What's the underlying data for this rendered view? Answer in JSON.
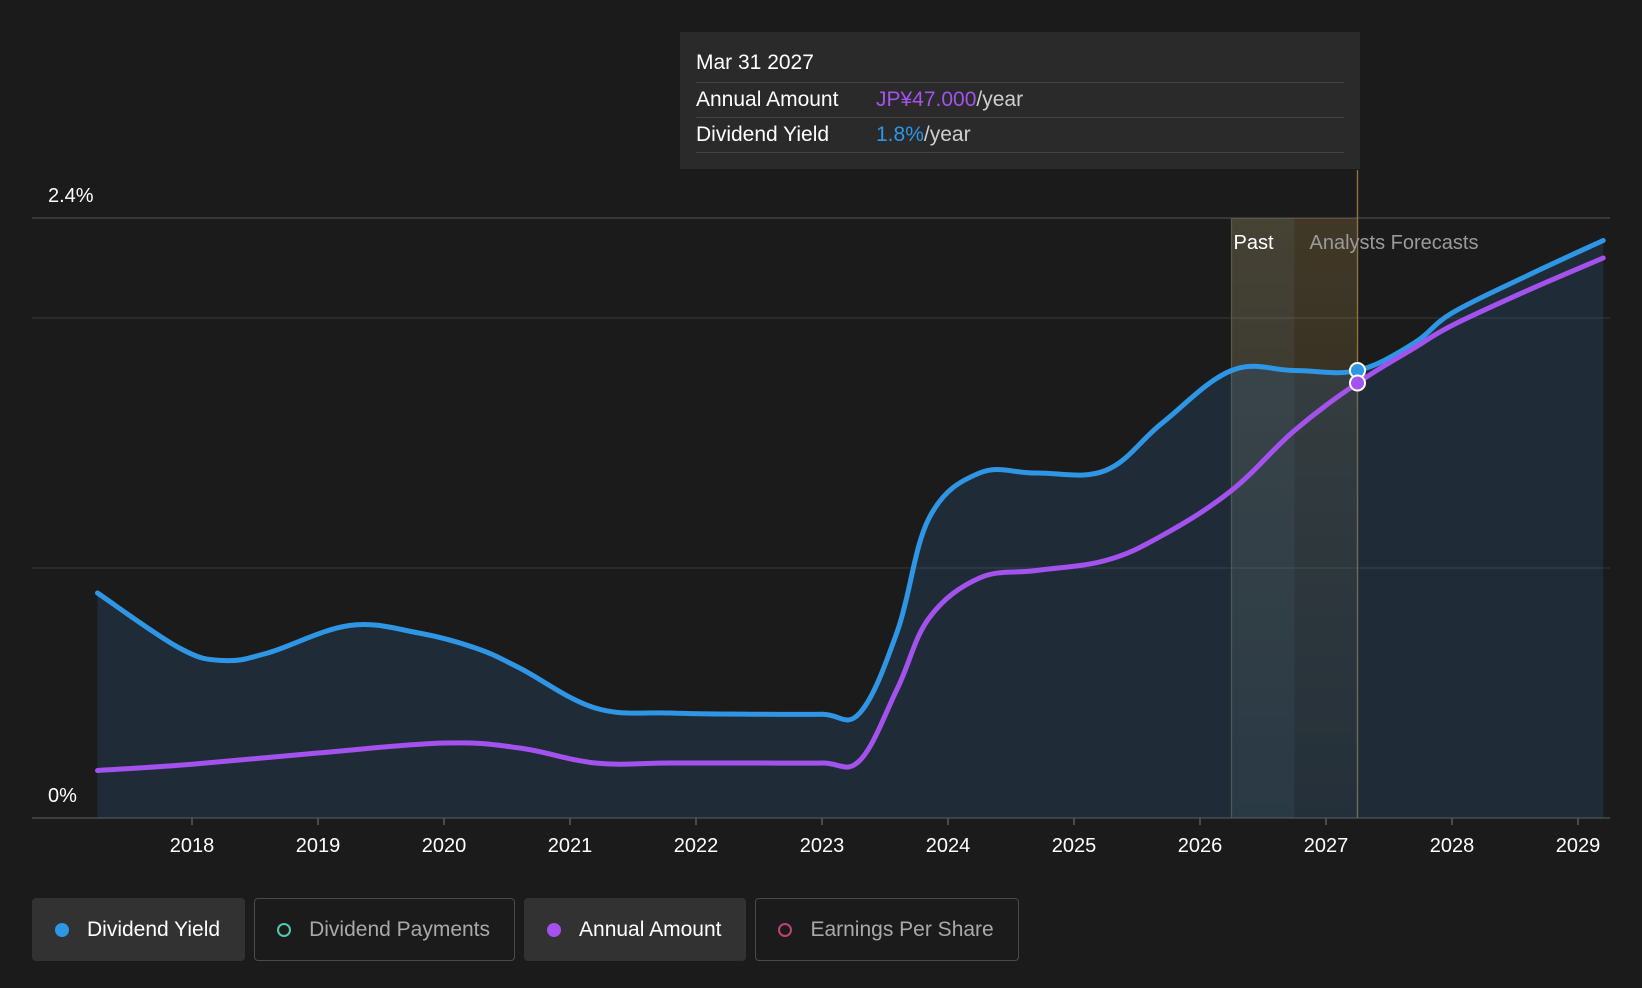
{
  "colors": {
    "background": "#1b1b1b",
    "dividend_yield": "#2e96e4",
    "annual_amount": "#a352ee",
    "dividend_payments": "#55c7b0",
    "earnings_per_share": "#c0407a",
    "forecast_band": "#c8a050",
    "gridline": "#3a3a3a"
  },
  "tooltip": {
    "date": "Mar 31 2027",
    "rows": [
      {
        "label": "Annual Amount",
        "value": "JP¥47.000",
        "unit": "/year"
      },
      {
        "label": "Dividend Yield",
        "value": "1.8%",
        "unit": "/year"
      }
    ]
  },
  "legend": [
    {
      "label": "Dividend Yield",
      "active": true,
      "icon": "filled-dot-icon"
    },
    {
      "label": "Dividend Payments",
      "active": false,
      "icon": "hollow-dot-icon"
    },
    {
      "label": "Annual Amount",
      "active": true,
      "icon": "filled-dot-icon"
    },
    {
      "label": "Earnings Per Share",
      "active": false,
      "icon": "hollow-dot-icon"
    }
  ],
  "chart_data": {
    "type": "line",
    "y_axis_labels": [
      "2.4%",
      "0%"
    ],
    "ylim": [
      0,
      2.4
    ],
    "xlim": [
      2017.25,
      2029.2
    ],
    "x_ticks": [
      2018,
      2019,
      2020,
      2021,
      2022,
      2023,
      2024,
      2025,
      2026,
      2027,
      2028,
      2029
    ],
    "gridlines_at": [
      2.4,
      2.0,
      1.0
    ],
    "past_label": "Past",
    "forecast_label": "Analysts Forecasts",
    "past_band": [
      2026.25,
      2026.75
    ],
    "forecast_divider": 2027.25,
    "highlight_x": 2027.25,
    "series": [
      {
        "name": "Dividend Yield",
        "color": "#2e96e4",
        "filled": true,
        "points": [
          [
            2017.25,
            0.9
          ],
          [
            2017.9,
            0.68
          ],
          [
            2018.25,
            0.63
          ],
          [
            2018.6,
            0.66
          ],
          [
            2019.25,
            0.77
          ],
          [
            2019.8,
            0.74
          ],
          [
            2020.25,
            0.68
          ],
          [
            2020.6,
            0.6
          ],
          [
            2021.2,
            0.44
          ],
          [
            2021.8,
            0.42
          ],
          [
            2022.5,
            0.415
          ],
          [
            2023.0,
            0.415
          ],
          [
            2023.3,
            0.42
          ],
          [
            2023.6,
            0.75
          ],
          [
            2023.85,
            1.2
          ],
          [
            2024.25,
            1.38
          ],
          [
            2024.7,
            1.38
          ],
          [
            2025.25,
            1.39
          ],
          [
            2025.7,
            1.58
          ],
          [
            2026.25,
            1.79
          ],
          [
            2026.75,
            1.79
          ],
          [
            2027.25,
            1.79
          ],
          [
            2027.7,
            1.9
          ],
          [
            2028.0,
            2.02
          ],
          [
            2028.6,
            2.17
          ],
          [
            2029.2,
            2.31
          ]
        ]
      },
      {
        "name": "Annual Amount",
        "color": "#a352ee",
        "filled": false,
        "points": [
          [
            2017.25,
            0.19
          ],
          [
            2018.0,
            0.215
          ],
          [
            2019.0,
            0.26
          ],
          [
            2020.0,
            0.3
          ],
          [
            2020.6,
            0.28
          ],
          [
            2021.2,
            0.22
          ],
          [
            2021.8,
            0.22
          ],
          [
            2022.5,
            0.22
          ],
          [
            2023.0,
            0.22
          ],
          [
            2023.3,
            0.23
          ],
          [
            2023.6,
            0.52
          ],
          [
            2023.85,
            0.8
          ],
          [
            2024.25,
            0.96
          ],
          [
            2024.7,
            0.99
          ],
          [
            2025.25,
            1.03
          ],
          [
            2025.7,
            1.13
          ],
          [
            2026.25,
            1.31
          ],
          [
            2026.75,
            1.55
          ],
          [
            2027.25,
            1.74
          ],
          [
            2027.7,
            1.88
          ],
          [
            2028.0,
            1.97
          ],
          [
            2028.6,
            2.11
          ],
          [
            2029.2,
            2.24
          ]
        ]
      }
    ]
  }
}
